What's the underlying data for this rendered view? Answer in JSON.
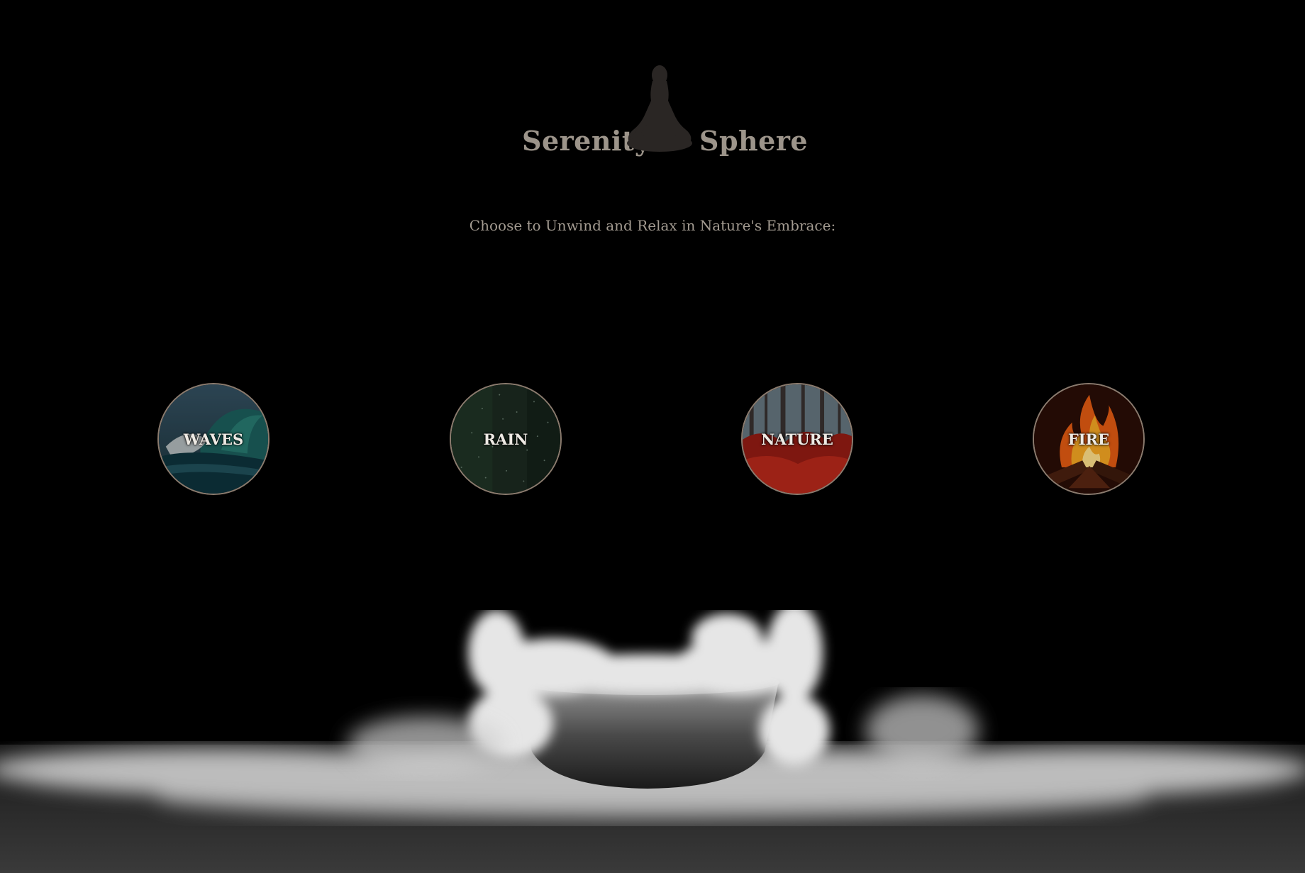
{
  "brand": {
    "word_left": "Serenity",
    "word_right": "Sphere",
    "figure_icon": "meditation-figure-icon"
  },
  "tagline": "Choose to Unwind and Relax in Nature's Embrace:",
  "options": [
    {
      "label": "WAVES",
      "icon": "ocean-wave-image"
    },
    {
      "label": "RAIN",
      "icon": "rain-image"
    },
    {
      "label": "NATURE",
      "icon": "autumn-forest-image"
    },
    {
      "label": "FIRE",
      "icon": "campfire-image"
    }
  ],
  "background": {
    "scene": "dry-ice-fog-bowl",
    "colors": {
      "bg": "#000000",
      "text": "#9c948a",
      "ring": "#8b7b6e"
    }
  }
}
